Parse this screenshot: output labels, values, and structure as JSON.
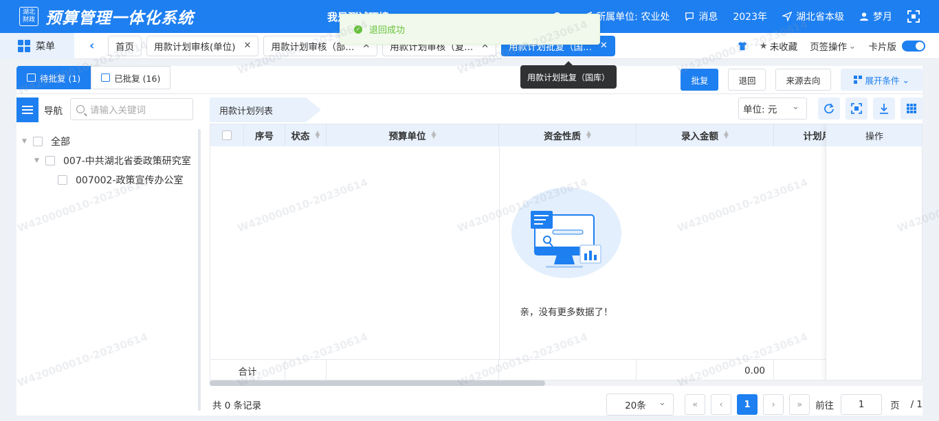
{
  "header": {
    "logo_text": "湖北财政",
    "app_title": "预算管理一体化系统",
    "center_title": "我是测试环境",
    "unit_label": "所属单位: 农业处",
    "messages": "消息",
    "year": "2023年",
    "region": "湖北省本级",
    "user": "梦月"
  },
  "toast": {
    "message": "退回成功"
  },
  "tabbar": {
    "menu": "菜单",
    "tabs": [
      {
        "label": "首页",
        "closable": false
      },
      {
        "label": "用款计划审核(单位)",
        "closable": true
      },
      {
        "label": "用款计划审核（部...",
        "closable": true
      },
      {
        "label": "用款计划审核（复...",
        "closable": true
      },
      {
        "label": "用款计划批复（国...",
        "closable": true
      }
    ],
    "favorite": "未收藏",
    "tab_ops": "页签操作",
    "card_mode": "卡片版"
  },
  "tooltip": "用款计划批复（国库）",
  "subtabs": {
    "pending": "待批复 (1)",
    "done": "已批复 (16)"
  },
  "actions": {
    "approve": "批复",
    "return": "退回",
    "trace": "来源去向",
    "expand": "展开条件"
  },
  "nav": {
    "label": "导航",
    "search_placeholder": "请输入关键词",
    "tree": [
      "全部",
      "007-中共湖北省委政策研究室",
      "007002-政策宣传办公室"
    ]
  },
  "list": {
    "title": "用款计划列表",
    "unit_label": "单位:",
    "unit_value": "元",
    "columns": [
      "序号",
      "状态",
      "预算单位",
      "资金性质",
      "录入金额",
      "计划月份",
      "操作"
    ],
    "empty_text": "亲，没有更多数据了！",
    "sum_label": "合计",
    "sum_amount": "0.00"
  },
  "pager": {
    "total": "共 0 条记录",
    "page_size": "20条",
    "current": "1",
    "goto_label": "前往",
    "goto_value": "1",
    "page_unit": "页",
    "page_total": "/ 1"
  },
  "watermark": "W420000010-20230614",
  "colors": {
    "primary": "#1e7ff0",
    "success": "#67c23a"
  }
}
